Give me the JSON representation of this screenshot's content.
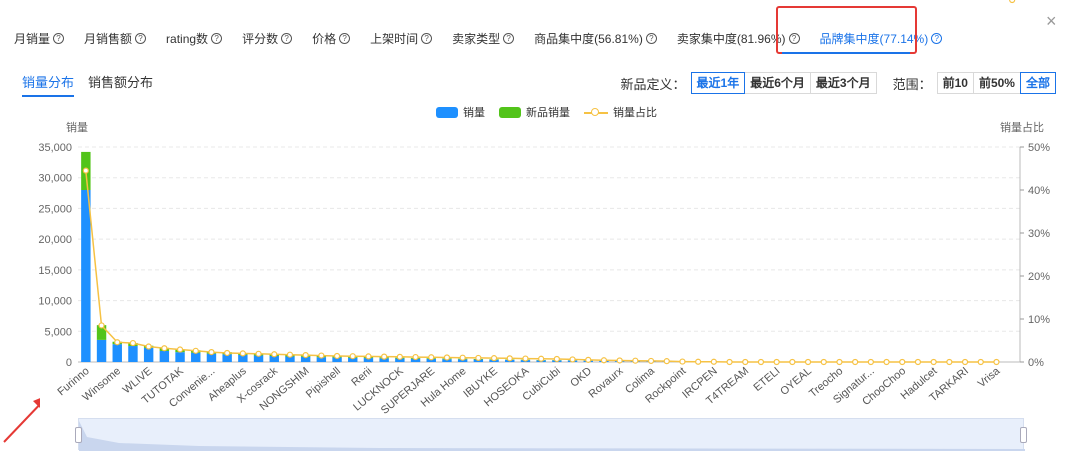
{
  "tabs": [
    {
      "label": "月销量",
      "active": false
    },
    {
      "label": "月销售额",
      "active": false
    },
    {
      "label": "rating数",
      "active": false
    },
    {
      "label": "评分数",
      "active": false
    },
    {
      "label": "价格",
      "active": false
    },
    {
      "label": "上架时间",
      "active": false
    },
    {
      "label": "卖家类型",
      "active": false
    },
    {
      "label": "商品集中度(56.81%)",
      "active": false
    },
    {
      "label": "卖家集中度(81.96%)",
      "active": false
    },
    {
      "label": "品牌集中度(77.14%)",
      "active": true
    }
  ],
  "close_symbol": "×",
  "subtabs": [
    {
      "label": "销量分布",
      "active": true
    },
    {
      "label": "销售额分布",
      "active": false
    }
  ],
  "filters": {
    "new_product_label": "新品定义：",
    "new_product_options": [
      {
        "label": "最近1年",
        "active": true
      },
      {
        "label": "最近6个月",
        "active": false
      },
      {
        "label": "最近3个月",
        "active": false
      }
    ],
    "range_label": "范围：",
    "range_options": [
      {
        "label": "前10",
        "active": false
      },
      {
        "label": "前50%",
        "active": false
      },
      {
        "label": "全部",
        "active": true
      }
    ]
  },
  "colors": {
    "sales": "#1e90ff",
    "new_sales": "#52c41a",
    "share": "#f6c244",
    "accent": "#1a73e8",
    "highlight": "#e53935"
  },
  "chart_data": {
    "type": "bar",
    "stacked": true,
    "ylabel": "销量",
    "y2label": "销量占比",
    "ylim": [
      0,
      35000
    ],
    "y2lim": [
      0,
      50
    ],
    "yticks": [
      "0",
      "5,000",
      "10,000",
      "15,000",
      "20,000",
      "25,000",
      "30,000",
      "35,000"
    ],
    "y2ticks": [
      "0%",
      "10%",
      "20%",
      "30%",
      "40%",
      "50%"
    ],
    "legend": [
      {
        "name": "销量",
        "kind": "bar"
      },
      {
        "name": "新品销量",
        "kind": "bar"
      },
      {
        "name": "销量占比",
        "kind": "line"
      }
    ],
    "categories": [
      "Furinno",
      "",
      "Winsome",
      "",
      "WLIVE",
      "",
      "TUTOTAK",
      "",
      "Convenie...",
      "",
      "Aheaplus",
      "",
      "X-cosrack",
      "",
      "NONGSHIM",
      "",
      "Pipishell",
      "",
      "Rerii",
      "",
      "LUCKNOCK",
      "",
      "SUPERJARE",
      "",
      "Hula Home",
      "",
      "IBUYKE",
      "",
      "HOSEOKA",
      "",
      "CubiCubi",
      "",
      "OKD",
      "",
      "Rovaurx",
      "",
      "Colima",
      "",
      "Rockpoint",
      "",
      "IRCPEN",
      "",
      "T4TREAM",
      "",
      "ETELI",
      "",
      "OYEAL",
      "",
      "Treocho",
      "",
      "Signatur...",
      "",
      "ChooChoo",
      "",
      "Hadulcet",
      "",
      "TARKARI",
      "",
      "Vrisa",
      ""
    ],
    "series": [
      {
        "name": "销量",
        "values": [
          28000,
          3600,
          2900,
          2600,
          2300,
          1800,
          1600,
          1500,
          1350,
          1250,
          1150,
          1050,
          980,
          900,
          840,
          780,
          720,
          680,
          640,
          600,
          560,
          520,
          490,
          460,
          430,
          400,
          370,
          340,
          310,
          280,
          260,
          240,
          220,
          200,
          180,
          160,
          140,
          120,
          60,
          40,
          20,
          15,
          10,
          8,
          6,
          5,
          4,
          3,
          2,
          2,
          2,
          1,
          1,
          1,
          1,
          1,
          1,
          1,
          1
        ]
      },
      {
        "name": "新品销量",
        "values": [
          6200,
          2400,
          400,
          500,
          350,
          500,
          450,
          400,
          280,
          350,
          300,
          280,
          250,
          250,
          220,
          200,
          180,
          170,
          160,
          150,
          140,
          130,
          120,
          110,
          100,
          90,
          80,
          70,
          60,
          50,
          45,
          40,
          35,
          30,
          25,
          20,
          15,
          10,
          5,
          3,
          2,
          1,
          1,
          0,
          0,
          0,
          0,
          0,
          0,
          0,
          0,
          0,
          0,
          0,
          0,
          0,
          0,
          0,
          0
        ]
      },
      {
        "name": "销量占比",
        "values": [
          44.5,
          8.5,
          4.6,
          4.4,
          3.6,
          3.2,
          2.9,
          2.6,
          2.3,
          2.1,
          2.0,
          1.9,
          1.8,
          1.7,
          1.6,
          1.5,
          1.4,
          1.35,
          1.3,
          1.25,
          1.2,
          1.15,
          1.1,
          1.05,
          1.0,
          0.95,
          0.9,
          0.85,
          0.8,
          0.75,
          0.7,
          0.6,
          0.5,
          0.4,
          0.35,
          0.3,
          0.25,
          0.2,
          0.1,
          0.05,
          0.05,
          0,
          0,
          0,
          0,
          0,
          0,
          0,
          0,
          0,
          0,
          0,
          0,
          0,
          0,
          0,
          0,
          0,
          0
        ]
      }
    ],
    "grid": true,
    "legend_position": "top-center"
  }
}
